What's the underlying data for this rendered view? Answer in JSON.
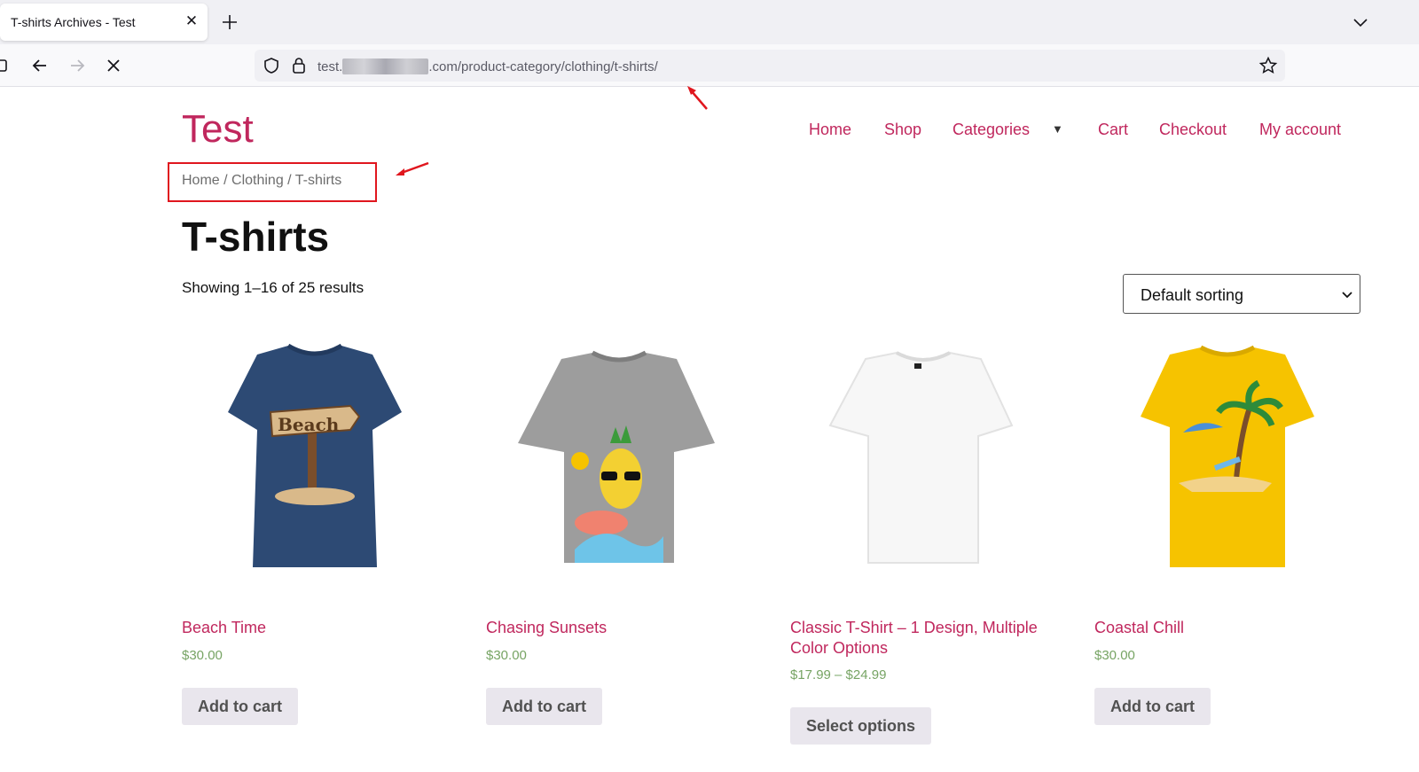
{
  "browser": {
    "tab_title": "T-shirts Archives - Test",
    "url_prefix": "test.",
    "url_suffix": ".com/product-category/clothing/t-shirts/"
  },
  "site": {
    "title": "Test",
    "menu": [
      "Home",
      "Shop",
      "Categories",
      "Cart",
      "Checkout",
      "My account"
    ]
  },
  "breadcrumb": "Home / Clothing / T-shirts",
  "page_title": "T-shirts",
  "result_count": "Showing 1–16 of 25 results",
  "sorting": {
    "selected": "Default sorting"
  },
  "products": [
    {
      "name": "Beach Time",
      "price": "$30.00",
      "button": "Add to cart",
      "shirt_color": "#2d4a74"
    },
    {
      "name": "Chasing Sunsets",
      "price": "$30.00",
      "button": "Add to cart",
      "shirt_color": "#9d9d9d"
    },
    {
      "name": "Classic T-Shirt – 1 Design, Multiple Color Options",
      "price": "$17.99 – $24.99",
      "button": "Select options",
      "shirt_color": "#f7f7f7"
    },
    {
      "name": "Coastal Chill",
      "price": "$30.00",
      "button": "Add to cart",
      "shirt_color": "#f6c300"
    }
  ],
  "colors": {
    "accent": "#c0275d",
    "price": "#77a464",
    "annotation": "#e0161e"
  }
}
